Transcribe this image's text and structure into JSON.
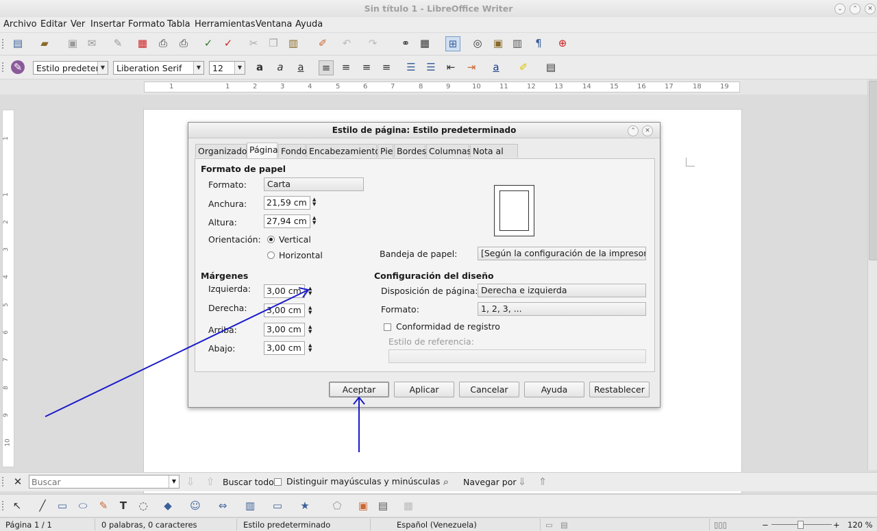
{
  "window": {
    "title": "Sin título 1 - LibreOffice Writer"
  },
  "menu": [
    "Archivo",
    "Editar",
    "Ver",
    "Insertar",
    "Formato",
    "Tabla",
    "Herramientas",
    "Ventana",
    "Ayuda"
  ],
  "format_bar": {
    "style": "Estilo predetem",
    "font": "Liberation Serif",
    "size": "12"
  },
  "ruler_numbers": [
    "1",
    "1",
    "2",
    "3",
    "4",
    "5",
    "6",
    "7",
    "8",
    "9",
    "10",
    "11",
    "12",
    "13",
    "14",
    "15",
    "16",
    "17",
    "18",
    "19"
  ],
  "vruler_numbers": [
    "1",
    "1",
    "2",
    "3",
    "4",
    "5",
    "6",
    "7",
    "8",
    "9",
    "10"
  ],
  "dialog": {
    "title": "Estilo de página: Estilo predeterminado",
    "tabs": [
      "Organizador",
      "Página",
      "Fondo",
      "Encabezamiento",
      "Pie",
      "Bordes",
      "Columnas",
      "Nota al pie"
    ],
    "active_tab": "Página",
    "paper": {
      "heading": "Formato de papel",
      "format_label": "Formato:",
      "format_value": "Carta",
      "width_label": "Anchura:",
      "width_value": "21,59 cm",
      "height_label": "Altura:",
      "height_value": "27,94 cm",
      "orientation_label": "Orientación:",
      "vertical": "Vertical",
      "horizontal": "Horizontal",
      "tray_label": "Bandeja de papel:",
      "tray_value": "[Según la configuración de la impresora]"
    },
    "margins": {
      "heading": "Márgenes",
      "left_label": "Izquierda:",
      "left_value": "3,00 cm",
      "right_label": "Derecha:",
      "right_value": "3,00 cm",
      "top_label": "Arriba:",
      "top_value": "3,00 cm",
      "bottom_label": "Abajo:",
      "bottom_value": "3,00 cm"
    },
    "layout": {
      "heading": "Configuración del diseño",
      "page_layout_label": "Disposición de página:",
      "page_layout_value": "Derecha e izquierda",
      "format_label": "Formato:",
      "format_value": "1, 2, 3, ...",
      "register_label": "Conformidad de registro",
      "reference_label": "Estilo de referencia:"
    },
    "buttons": {
      "ok": "Aceptar",
      "apply": "Aplicar",
      "cancel": "Cancelar",
      "help": "Ayuda",
      "reset": "Restablecer"
    }
  },
  "findbar": {
    "placeholder": "Buscar",
    "find_all": "Buscar todo",
    "match_case": "Distinguir mayúsculas y minúsculas",
    "navigate": "Navegar por"
  },
  "status": {
    "page": "Página 1 / 1",
    "words": "0 palabras, 0 caracteres",
    "style": "Estilo predeterminado",
    "language": "Español (Venezuela)",
    "zoom": "120 %"
  },
  "colors": {
    "arrow": "#1a1acc",
    "accent": "#3a5f9a"
  }
}
